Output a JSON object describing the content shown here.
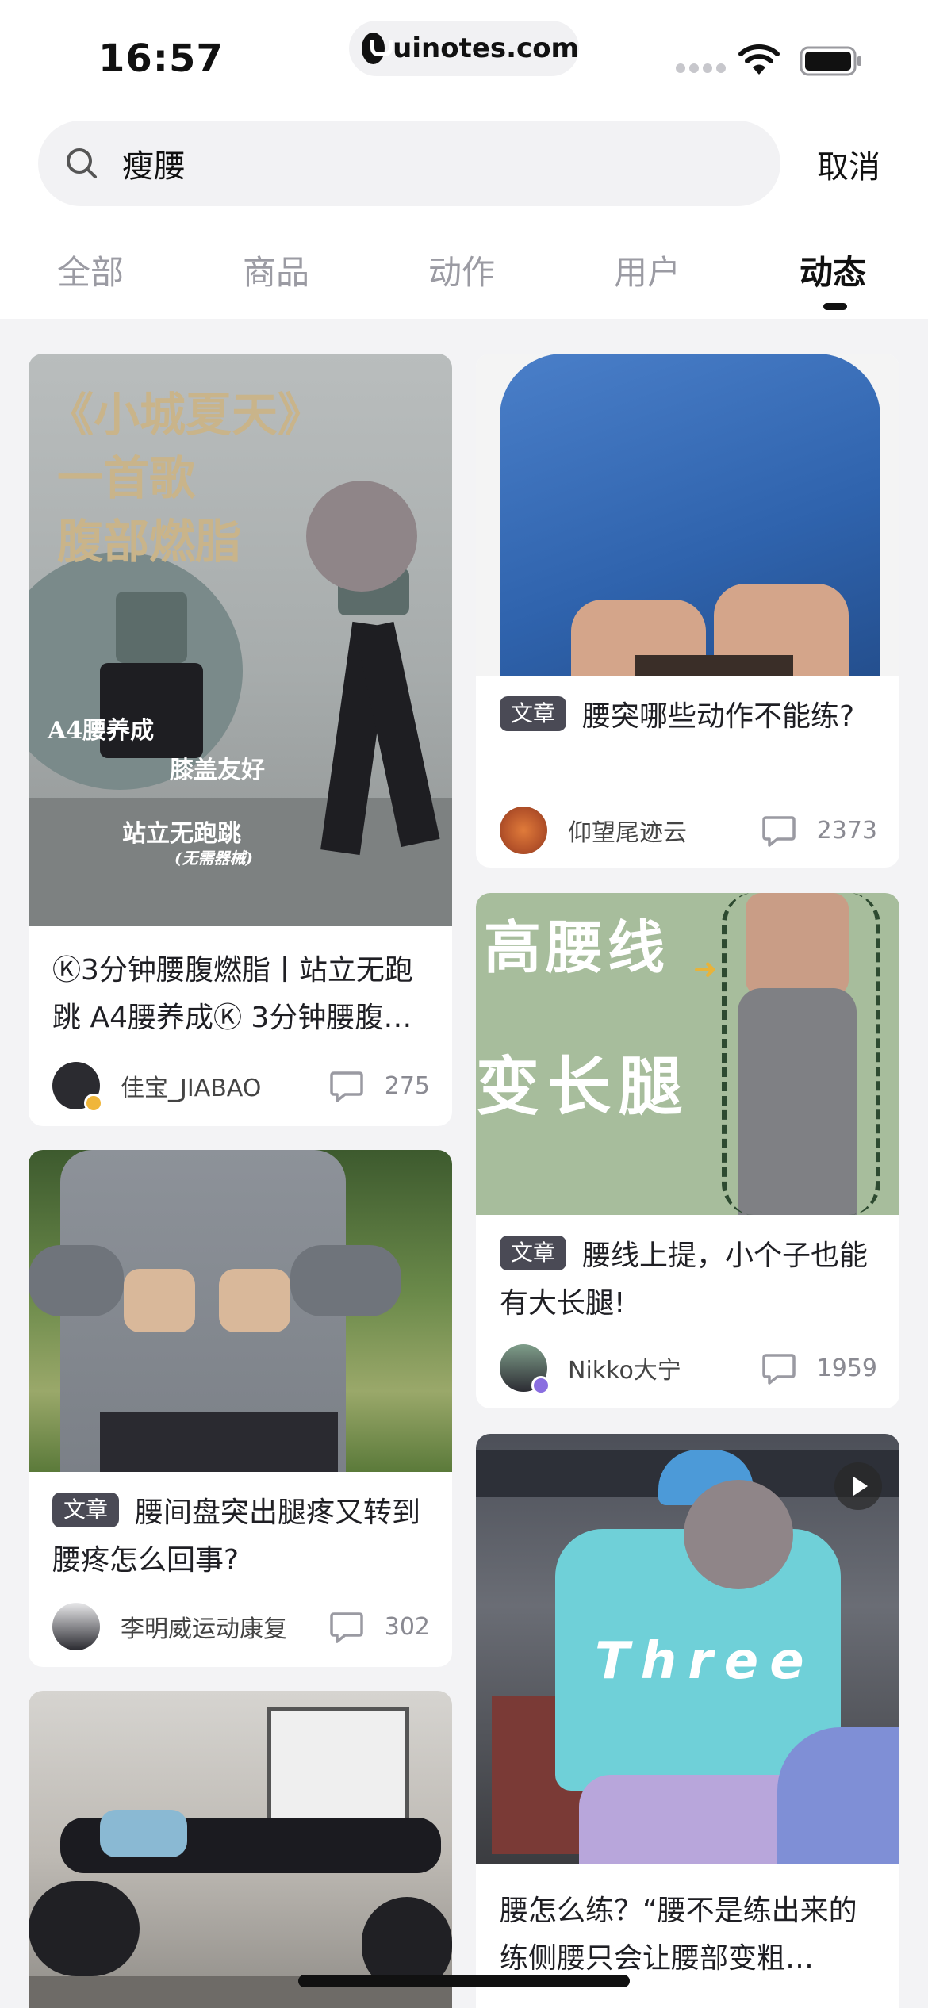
{
  "status_bar": {
    "time": "16:57",
    "url": "uinotes.com"
  },
  "search": {
    "value": "瘦腰",
    "cancel_label": "取消"
  },
  "tabs": [
    {
      "label": "全部"
    },
    {
      "label": "商品"
    },
    {
      "label": "动作"
    },
    {
      "label": "用户"
    },
    {
      "label": "动态",
      "active": true
    }
  ],
  "feed": {
    "left": [
      {
        "image_text": {
          "line1": "《小城夏天》",
          "line2": "一首歌",
          "line3": "腹部燃脂",
          "label_a4": "A4腰养成",
          "label_knee": "膝盖友好",
          "label_stand": "站立无跑跳",
          "label_equipment": "(无需器械)"
        },
        "title": "Ⓚ3分钟腰腹燃脂丨站立无跑跳 A4腰养成Ⓚ 3分钟腰腹燃脂",
        "author": "佳宝_JIABAO",
        "comments": "275"
      },
      {
        "tag": "文章",
        "title": "腰间盘突出腿疼又转到腰疼怎么回事?",
        "author": "李明威运动康复",
        "comments": "302"
      },
      {
        "image_only": true
      }
    ],
    "right": [
      {
        "tag": "文章",
        "title": "腰突哪些动作不能练?",
        "author": "仰望尾迹云",
        "comments": "2373"
      },
      {
        "image_text": {
          "line1": "高腰线",
          "line2": "变长腿"
        },
        "tag": "文章",
        "title": "腰线上提，小个子也能有大长腿!",
        "author": "Nikko大宁",
        "comments": "1959"
      },
      {
        "image_text": {
          "overlay": "Three"
        },
        "title": "腰怎么练？“腰不是练出来的练侧腰只会让腰部变粗…"
      }
    ]
  },
  "colors": {
    "accent": "#111111",
    "tag_bg": "#4a4a55",
    "page_bg": "#f3f3f5"
  }
}
